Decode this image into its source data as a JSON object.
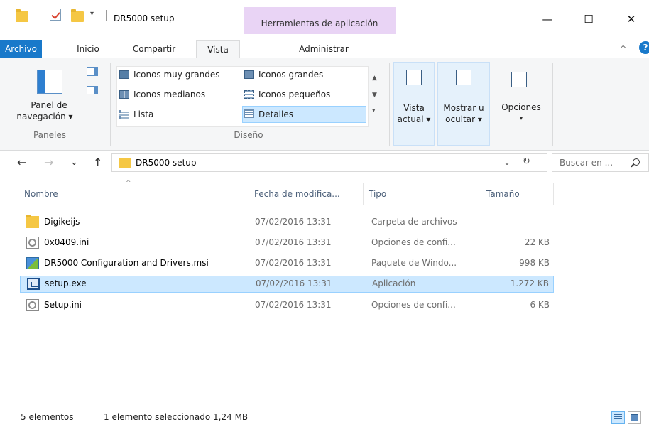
{
  "window": {
    "title": "DR5000 setup",
    "qa_dropdown": "▾",
    "context_tab_header": "Herramientas de aplicación",
    "minimize": "—",
    "maximize": "☐",
    "close": "✕"
  },
  "ribbon_tabs": {
    "file": "Archivo",
    "home": "Inicio",
    "share": "Compartir",
    "view": "Vista",
    "manage": "Administrar",
    "collapse": "^",
    "help": "?"
  },
  "ribbon": {
    "panes": {
      "nav_pane_line1": "Panel de",
      "nav_pane_line2": "navegación ▾",
      "group_label": "Paneles"
    },
    "layout": {
      "items": [
        {
          "label": "Iconos muy grandes",
          "icon": "extra-large-icons-icon"
        },
        {
          "label": "Iconos grandes",
          "icon": "large-icons-icon"
        },
        {
          "label": "Iconos medianos",
          "icon": "medium-icons-icon"
        },
        {
          "label": "Iconos pequeños",
          "icon": "small-icons-icon"
        },
        {
          "label": "Lista",
          "icon": "list-icon"
        },
        {
          "label": "Detalles",
          "icon": "details-icon",
          "selected": true
        }
      ],
      "scroll_up": "▲",
      "scroll_down": "▼",
      "scroll_more": "▾",
      "group_label": "Diseño"
    },
    "current_view": {
      "line1": "Vista",
      "line2": "actual ▾"
    },
    "show_hide": {
      "line1": "Mostrar u",
      "line2": "ocultar ▾"
    },
    "options": {
      "line1": "Opciones",
      "line2": "▾"
    }
  },
  "nav": {
    "back": "←",
    "forward": "→",
    "recent": "⌄",
    "up": "↑",
    "address": "DR5000 setup",
    "address_chevron": "⌄",
    "refresh": "↻",
    "search_placeholder": "Buscar en ..."
  },
  "columns": {
    "name": "Nombre",
    "date": "Fecha de modifica...",
    "type": "Tipo",
    "size": "Tamaño",
    "sort_caret": "^"
  },
  "files": [
    {
      "name": "Digikeijs",
      "date": "07/02/2016 13:31",
      "type": "Carpeta de archivos",
      "size": "",
      "icon": "folder-icon"
    },
    {
      "name": "0x0409.ini",
      "date": "07/02/2016 13:31",
      "type": "Opciones de confi...",
      "size": "22 KB",
      "icon": "ini-file-icon"
    },
    {
      "name": "DR5000 Configuration and Drivers.msi",
      "date": "07/02/2016 13:31",
      "type": "Paquete de Windo...",
      "size": "998 KB",
      "icon": "msi-package-icon"
    },
    {
      "name": "setup.exe",
      "date": "07/02/2016 13:31",
      "type": "Aplicación",
      "size": "1.272 KB",
      "icon": "exe-app-icon",
      "selected": true
    },
    {
      "name": "Setup.ini",
      "date": "07/02/2016 13:31",
      "type": "Opciones de confi...",
      "size": "6 KB",
      "icon": "ini-file-icon"
    }
  ],
  "status": {
    "count": "5 elementos",
    "selection": "1 elemento seleccionado  1,24 MB"
  },
  "colors": {
    "accent": "#1979ca",
    "context_tab": "#e9d4f5",
    "selection": "#cce8ff",
    "selection_border": "#99d1ff",
    "folder": "#f5c744"
  }
}
